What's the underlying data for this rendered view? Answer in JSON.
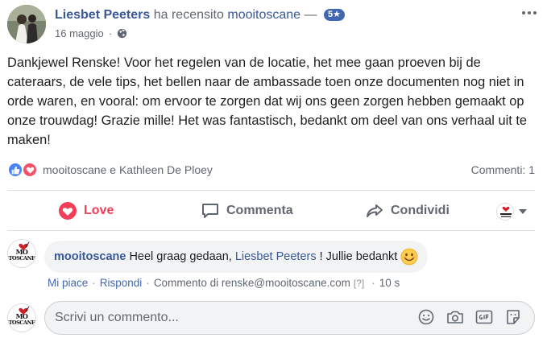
{
  "post": {
    "author": "Liesbet Peeters",
    "verb": "ha recensito",
    "page": "mooitoscane",
    "dash": "—",
    "rating": "5★",
    "date": "16 maggio",
    "date_separator": "·",
    "audience_icon": "globe-icon",
    "text": "Dankjewel Renske! Voor het regelen van de locatie, het mee gaan proeven bij de cateraars, de vele tips, het bellen naar de ambassade toen onze documenten nog niet in orde waren, en vooral: om ervoor te zorgen dat wij ons geen zorgen hebben gemaakt op onze trouwdag! Grazie mille! Het was fantastisch, bedankt om deel van ons verhaal uit te maken!"
  },
  "reactions": {
    "icons": [
      "like-icon",
      "love-icon"
    ],
    "people": "mooitoscane e Kathleen De Ploey",
    "comments_count": "Commenti: 1"
  },
  "actions": {
    "love_label": "Love",
    "comment_label": "Commenta",
    "share_label": "Condividi"
  },
  "logo": {
    "line1": "MO",
    "line2": "TOSCANE"
  },
  "comment": {
    "author": "mooitoscane",
    "text_before": "Heel graag gedaan,",
    "mention": "Liesbet Peeters",
    "text_after": "! Jullie bedankt",
    "emoji": "smiley-icon",
    "like": "Mi piace",
    "reply": "Rispondi",
    "separator": "·",
    "by": "Commento di renske@mooitoscane.com",
    "help": "[?]",
    "time": "10 s"
  },
  "composer": {
    "placeholder": "Scrivi un commento...",
    "icons": [
      "emoji-icon",
      "camera-icon",
      "gif-icon",
      "sticker-icon"
    ]
  },
  "colors": {
    "link": "#385898",
    "love": "#f33e58",
    "like_blue": "#4a83f7",
    "rating_badge": "#4267b2",
    "muted": "#606770"
  }
}
